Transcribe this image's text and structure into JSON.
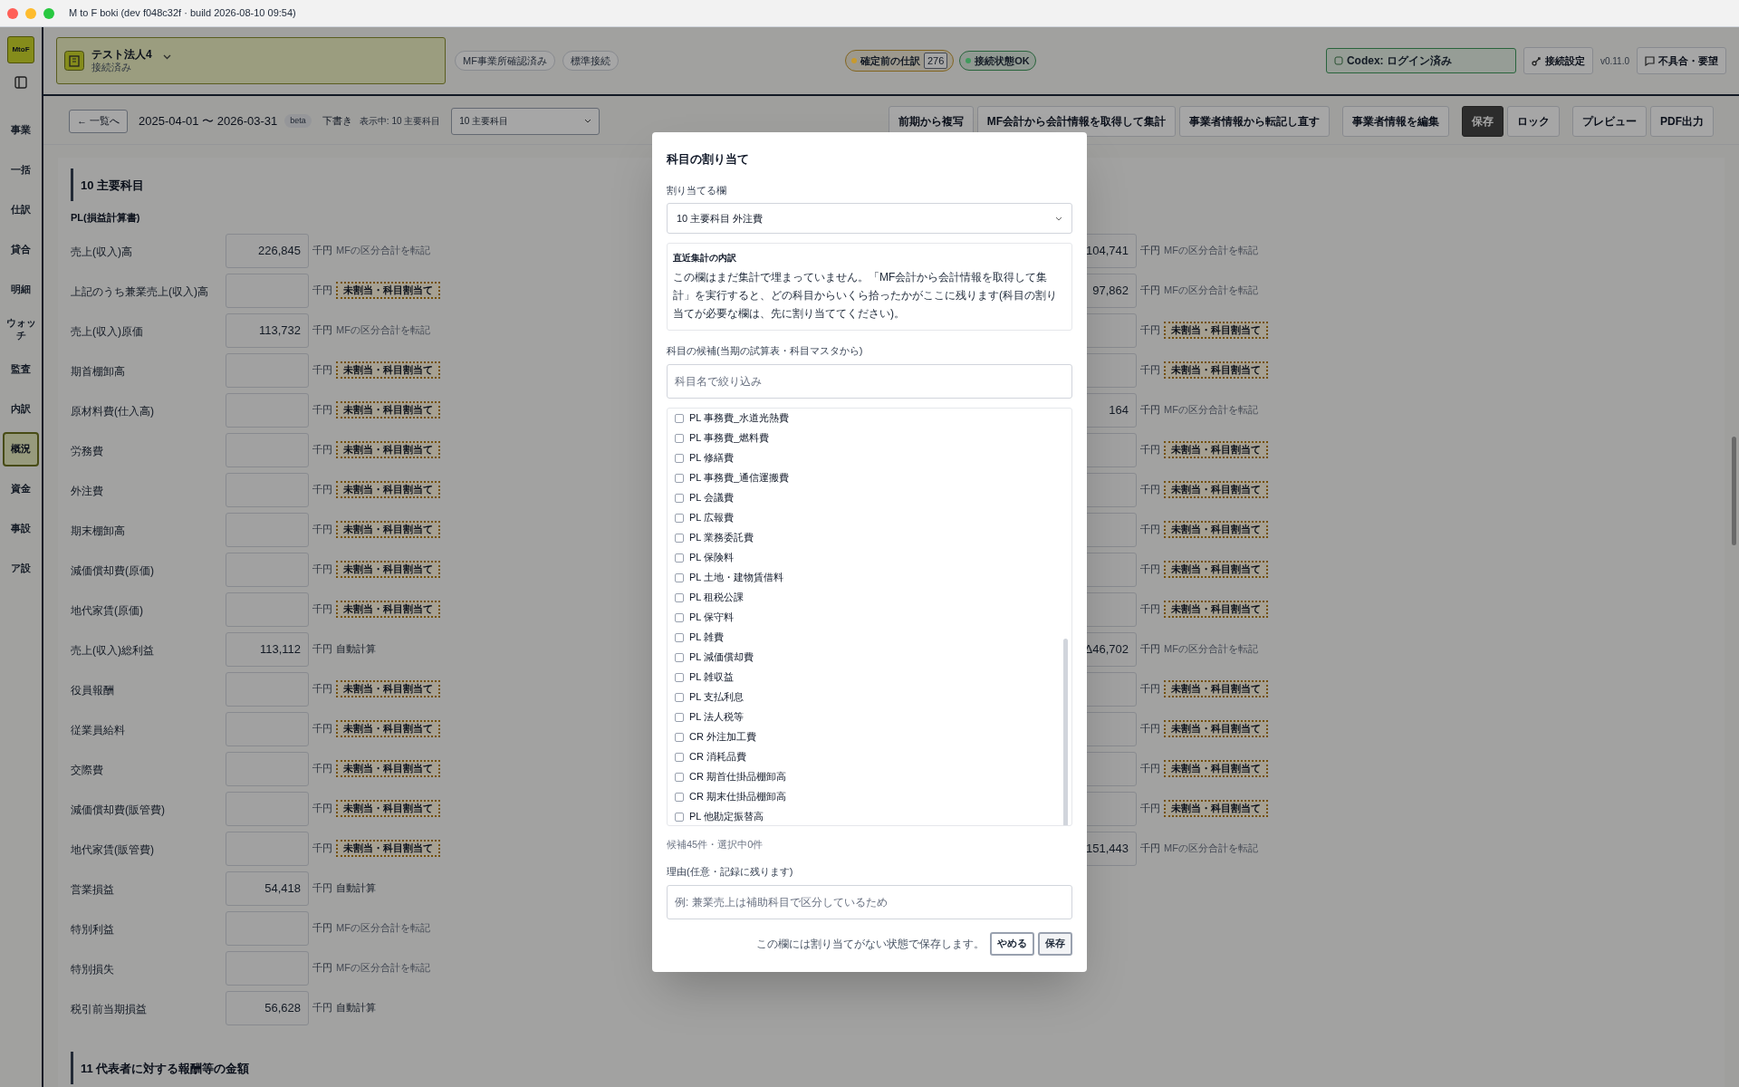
{
  "window": {
    "title": "M to F boki (dev f048c32f · build 2026-08-10 09:54)"
  },
  "sidebar": {
    "logo": "MtoF",
    "items": [
      {
        "label": "事業",
        "selected": false
      },
      {
        "label": "一括",
        "selected": false
      },
      {
        "label": "仕訳",
        "selected": false
      },
      {
        "label": "貸合",
        "selected": false
      },
      {
        "label": "明細",
        "selected": false
      },
      {
        "label": "ウォッチ",
        "selected": false
      },
      {
        "label": "監査",
        "selected": false
      },
      {
        "label": "内訳",
        "selected": false
      },
      {
        "label": "概況",
        "selected": true
      },
      {
        "label": "資金",
        "selected": false
      },
      {
        "label": "事設",
        "selected": false
      },
      {
        "label": "ア設",
        "selected": false
      }
    ]
  },
  "header": {
    "company": {
      "name": "テスト法人4",
      "status": "接続済み"
    },
    "chips": [
      "MF事業所確認済み",
      "標準接続"
    ],
    "indicators": [
      {
        "label": "確定前の仕訳",
        "count": "276",
        "color": "#c89a2e"
      },
      {
        "label": "接続状態OK",
        "color": "#3f9a5c"
      }
    ],
    "codex": "Codex: ログイン済み",
    "settings": "接続設定",
    "version": "v0.11.0",
    "feedback": "不具合・要望"
  },
  "toolbar": {
    "back": "← 一覧へ",
    "period": "2025-04-01 〜 2026-03-31",
    "badge": "beta",
    "status": "下書き",
    "showing": "表示中: 10 主要科目",
    "select": "10 主要科目",
    "button_groups": [
      [
        {
          "label": "前期から複写",
          "primary": false
        },
        {
          "label": "MF会計から会計情報を取得して集計",
          "primary": false
        },
        {
          "label": "事業者情報から転記し直す",
          "primary": false
        }
      ],
      [
        {
          "label": "事業者情報を編集",
          "primary": false
        }
      ],
      [
        {
          "label": "保存",
          "primary": true
        },
        {
          "label": "ロック",
          "primary": false
        }
      ],
      [
        {
          "label": "プレビュー",
          "primary": false
        },
        {
          "label": "PDF出力",
          "primary": false
        }
      ]
    ]
  },
  "section": {
    "title": "10 主要科目",
    "subtitle": "PL(損益計算書)",
    "rows": [
      {
        "label": "売上(収入)高",
        "value": "226,845",
        "unit": "千円",
        "note": {
          "kind": "transfer",
          "text": "MFの区分合計を転記"
        }
      },
      {
        "label": "上記のうち兼業売上(収入)高",
        "unit": "千円",
        "note": {
          "kind": "unassigned",
          "text": "未割当・科目割当て"
        }
      },
      {
        "label": "売上(収入)原価",
        "value": "113,732",
        "unit": "千円",
        "note": {
          "kind": "transfer",
          "text": "MFの区分合計を転記"
        }
      },
      {
        "label": "期首棚卸高",
        "unit": "千円",
        "note": {
          "kind": "unassigned",
          "text": "未割当・科目割当て"
        }
      },
      {
        "label": "原材料費(仕入高)",
        "unit": "千円",
        "note": {
          "kind": "unassigned",
          "text": "未割当・科目割当て"
        }
      },
      {
        "label": "労務費",
        "unit": "千円",
        "note": {
          "kind": "unassigned",
          "text": "未割当・科目割当て"
        }
      },
      {
        "label": "外注費",
        "unit": "千円",
        "note": {
          "kind": "unassigned",
          "text": "未割当・科目割当て"
        }
      },
      {
        "label": "期末棚卸高",
        "unit": "千円",
        "note": {
          "kind": "unassigned",
          "text": "未割当・科目割当て"
        }
      },
      {
        "label": "減価償却費(原価)",
        "unit": "千円",
        "note": {
          "kind": "unassigned",
          "text": "未割当・科目割当て"
        }
      },
      {
        "label": "地代家賃(原価)",
        "unit": "千円",
        "note": {
          "kind": "unassigned",
          "text": "未割当・科目割当て"
        }
      },
      {
        "label": "売上(収入)総利益",
        "value": "113,112",
        "unit": "千円",
        "note": {
          "kind": "auto",
          "text": "自動計算"
        }
      },
      {
        "label": "役員報酬",
        "unit": "千円",
        "note": {
          "kind": "unassigned",
          "text": "未割当・科目割当て"
        }
      },
      {
        "label": "従業員給料",
        "unit": "千円",
        "note": {
          "kind": "unassigned",
          "text": "未割当・科目割当て"
        }
      },
      {
        "label": "交際費",
        "unit": "千円",
        "note": {
          "kind": "unassigned",
          "text": "未割当・科目割当て"
        }
      },
      {
        "label": "減価償却費(販管費)",
        "unit": "千円",
        "note": {
          "kind": "unassigned",
          "text": "未割当・科目割当て"
        }
      },
      {
        "label": "地代家賃(販管費)",
        "unit": "千円",
        "note": {
          "kind": "unassigned",
          "text": "未割当・科目割当て"
        }
      },
      {
        "label": "営業損益",
        "value": "54,418",
        "unit": "千円",
        "note": {
          "kind": "auto",
          "text": "自動計算"
        }
      },
      {
        "label": "特別利益",
        "unit": "千円",
        "note": {
          "kind": "transfer",
          "text": "MFの区分合計を転記"
        }
      },
      {
        "label": "特別損失",
        "unit": "千円",
        "note": {
          "kind": "transfer",
          "text": "MFの区分合計を転記"
        }
      },
      {
        "label": "税引前当期損益",
        "value": "56,628",
        "unit": "千円",
        "note": {
          "kind": "auto",
          "text": "自動計算"
        }
      }
    ],
    "right_rows": [
      {
        "value": "104,741",
        "unit": "千円",
        "note": {
          "kind": "transfer",
          "text": "MFの区分合計を転記"
        }
      },
      {
        "value": "97,862",
        "unit": "千円",
        "note": {
          "kind": "transfer",
          "text": "MFの区分合計を転記"
        }
      },
      {
        "unit": "千円",
        "note": {
          "kind": "unassigned",
          "text": "未割当・科目割当て"
        }
      },
      {
        "unit": "千円",
        "note": {
          "kind": "unassigned",
          "text": "未割当・科目割当て"
        }
      },
      {
        "value": "164",
        "unit": "千円",
        "note": {
          "kind": "transfer",
          "text": "MFの区分合計を転記"
        }
      },
      {
        "unit": "千円",
        "note": {
          "kind": "unassigned",
          "text": "未割当・科目割当て"
        }
      },
      {
        "unit": "千円",
        "note": {
          "kind": "unassigned",
          "text": "未割当・科目割当て"
        }
      },
      {
        "unit": "千円",
        "note": {
          "kind": "unassigned",
          "text": "未割当・科目割当て"
        }
      },
      {
        "unit": "千円",
        "note": {
          "kind": "unassigned",
          "text": "未割当・科目割当て"
        }
      },
      {
        "unit": "千円",
        "note": {
          "kind": "unassigned",
          "text": "未割当・科目割当て"
        }
      },
      {
        "value": "Δ46,702",
        "unit": "千円",
        "note": {
          "kind": "transfer",
          "text": "MFの区分合計を転記"
        }
      },
      {
        "unit": "千円",
        "note": {
          "kind": "unassigned",
          "text": "未割当・科目割当て"
        }
      },
      {
        "unit": "千円",
        "note": {
          "kind": "unassigned",
          "text": "未割当・科目割当て"
        }
      },
      {
        "unit": "千円",
        "note": {
          "kind": "unassigned",
          "text": "未割当・科目割当て"
        }
      },
      {
        "unit": "千円",
        "note": {
          "kind": "unassigned",
          "text": "未割当・科目割当て"
        }
      },
      {
        "value": "151,443",
        "unit": "千円",
        "note": {
          "kind": "transfer",
          "text": "MFの区分合計を転記"
        }
      }
    ]
  },
  "next_section": {
    "title": "11 代表者に対する報酬等の金額"
  },
  "modal": {
    "title": "科目の割り当て",
    "target_label": "割り当てる欄",
    "target_value": "10 主要科目 外注費",
    "info_title": "直近集計の内訳",
    "info_text": "この欄はまだ集計で埋まっていません。「MF会計から会計情報を取得して集計」を実行すると、どの科目からいくら拾ったかがここに残ります(科目の割り当てが必要な欄は、先に割り当ててください)。",
    "candidates_label": "科目の候補(当期の試算表・科目マスタから)",
    "filter_placeholder": "科目名で絞り込み",
    "candidates": [
      {
        "label": "PL 事務費_水道光熱費",
        "checked": false
      },
      {
        "label": "PL 事務費_燃料費",
        "checked": false
      },
      {
        "label": "PL 修繕費",
        "checked": false
      },
      {
        "label": "PL 事務費_通信運搬費",
        "checked": false
      },
      {
        "label": "PL 会議費",
        "checked": false
      },
      {
        "label": "PL 広報費",
        "checked": false
      },
      {
        "label": "PL 業務委託費",
        "checked": false
      },
      {
        "label": "PL 保険料",
        "checked": false
      },
      {
        "label": "PL 土地・建物賃借料",
        "checked": false
      },
      {
        "label": "PL 租税公課",
        "checked": false
      },
      {
        "label": "PL 保守料",
        "checked": false
      },
      {
        "label": "PL 雑費",
        "checked": false
      },
      {
        "label": "PL 減価償却費",
        "checked": false
      },
      {
        "label": "PL 雑収益",
        "checked": false
      },
      {
        "label": "PL 支払利息",
        "checked": false
      },
      {
        "label": "PL 法人税等",
        "checked": false
      },
      {
        "label": "CR 外注加工費",
        "checked": false
      },
      {
        "label": "CR 消耗品費",
        "checked": false
      },
      {
        "label": "CR 期首仕掛品棚卸高",
        "checked": false
      },
      {
        "label": "CR 期末仕掛品棚卸高",
        "checked": false
      },
      {
        "label": "PL 他勘定振替高",
        "checked": false
      }
    ],
    "count": "候補45件・選択中0件",
    "reason_label": "理由(任意・記録に残ります)",
    "reason_placeholder": "例: 兼業売上は補助科目で区分しているため",
    "footer_note": "この欄には割り当てがない状態で保存します。",
    "buttons": [
      {
        "label": "やめる",
        "kind": "cancel"
      },
      {
        "label": "保存",
        "kind": "save"
      }
    ]
  }
}
